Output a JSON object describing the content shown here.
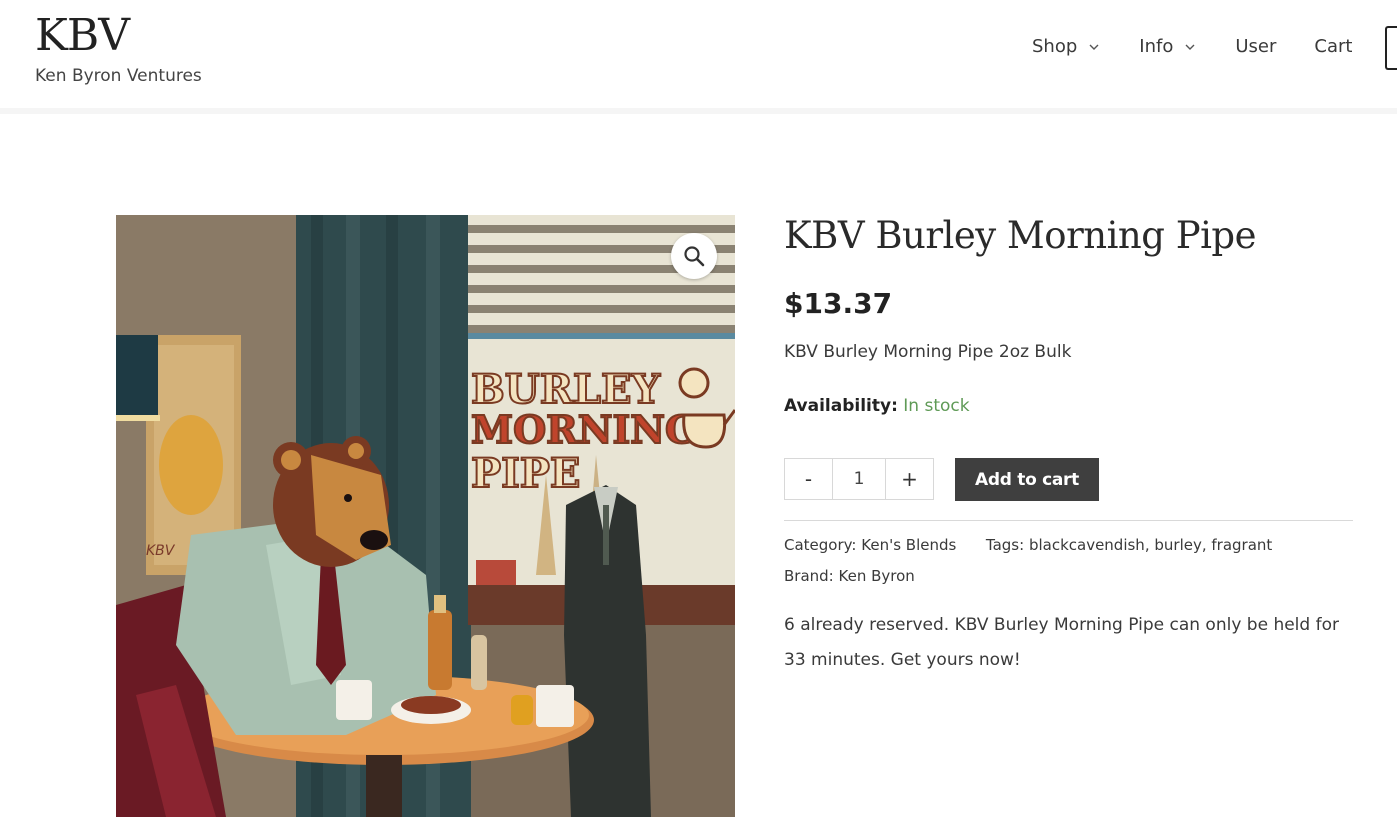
{
  "header": {
    "logo": "KBV",
    "tagline": "Ken Byron Ventures",
    "nav": [
      {
        "label": "Shop",
        "has_dropdown": true
      },
      {
        "label": "Info",
        "has_dropdown": true
      },
      {
        "label": "User",
        "has_dropdown": false
      },
      {
        "label": "Cart",
        "has_dropdown": false
      }
    ]
  },
  "product": {
    "title": "KBV Burley Morning Pipe",
    "price": "$13.37",
    "short_description": "KBV Burley Morning Pipe 2oz Bulk",
    "availability_label": "Availability:",
    "availability_value": "In stock",
    "quantity": "1",
    "qty_minus": "-",
    "qty_plus": "+",
    "add_to_cart_label": "Add to cart",
    "category_label": "Category:",
    "category": "Ken's Blends",
    "tags_label": "Tags:",
    "tags": [
      "blackcavendish",
      "burley",
      "fragrant"
    ],
    "brand_label": "Brand:",
    "brand": "Ken Byron",
    "notice": "6 already reserved. KBV Burley Morning Pipe can only be held for 33 minutes. Get yours now!",
    "image": {
      "lettering_line1": "BURLEY",
      "lettering_line2": "MORNING",
      "lettering_line3": "PIPE",
      "signature": "KBV"
    }
  },
  "colors": {
    "accent_green": "#5f9a56",
    "button_bg": "#3f3f3f"
  },
  "icons": {
    "zoom": "magnifier-icon",
    "dropdown": "chevron-down-icon"
  }
}
